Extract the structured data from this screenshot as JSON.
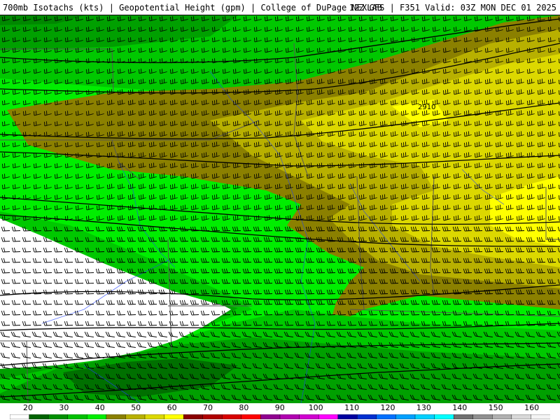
{
  "header": {
    "left": "700mb Isotachs (kts) | Geopotential Height (gpm) | College of DuPage NEXLAB",
    "right": "12Z GFS | F351 Valid: 03Z MON DEC 01 2025"
  },
  "map": {
    "contour_label": "2910",
    "colors": {
      "bg_white": "#ffffff",
      "dark_green": "#006400",
      "green": "#00a000",
      "mid_green": "#00c800",
      "bright_green": "#00ee00",
      "olive": "#8b8000",
      "dark_yellow": "#b8b000",
      "yellow": "#dcd800",
      "bright_yellow": "#ffff00",
      "contour": "#000000",
      "state_border": "#555555",
      "county_line": "#2040ff"
    }
  },
  "colorbar": {
    "ticks": [
      "20",
      "30",
      "40",
      "50",
      "60",
      "70",
      "80",
      "90",
      "100",
      "110",
      "120",
      "130",
      "140",
      "150",
      "160"
    ],
    "colors": [
      "#ffffff",
      "#006400",
      "#009000",
      "#00c000",
      "#00ee00",
      "#8b8000",
      "#b8b000",
      "#dcd800",
      "#ffff00",
      "#8b0000",
      "#b00000",
      "#d80000",
      "#ff0000",
      "#900090",
      "#b000b0",
      "#d000d0",
      "#ff00ff",
      "#0000a0",
      "#0030d0",
      "#0070ff",
      "#00a0ff",
      "#00d0ff",
      "#00ffff",
      "#707070",
      "#909090",
      "#b0b0b0",
      "#d8d8d8",
      "#f4f4f4"
    ]
  }
}
